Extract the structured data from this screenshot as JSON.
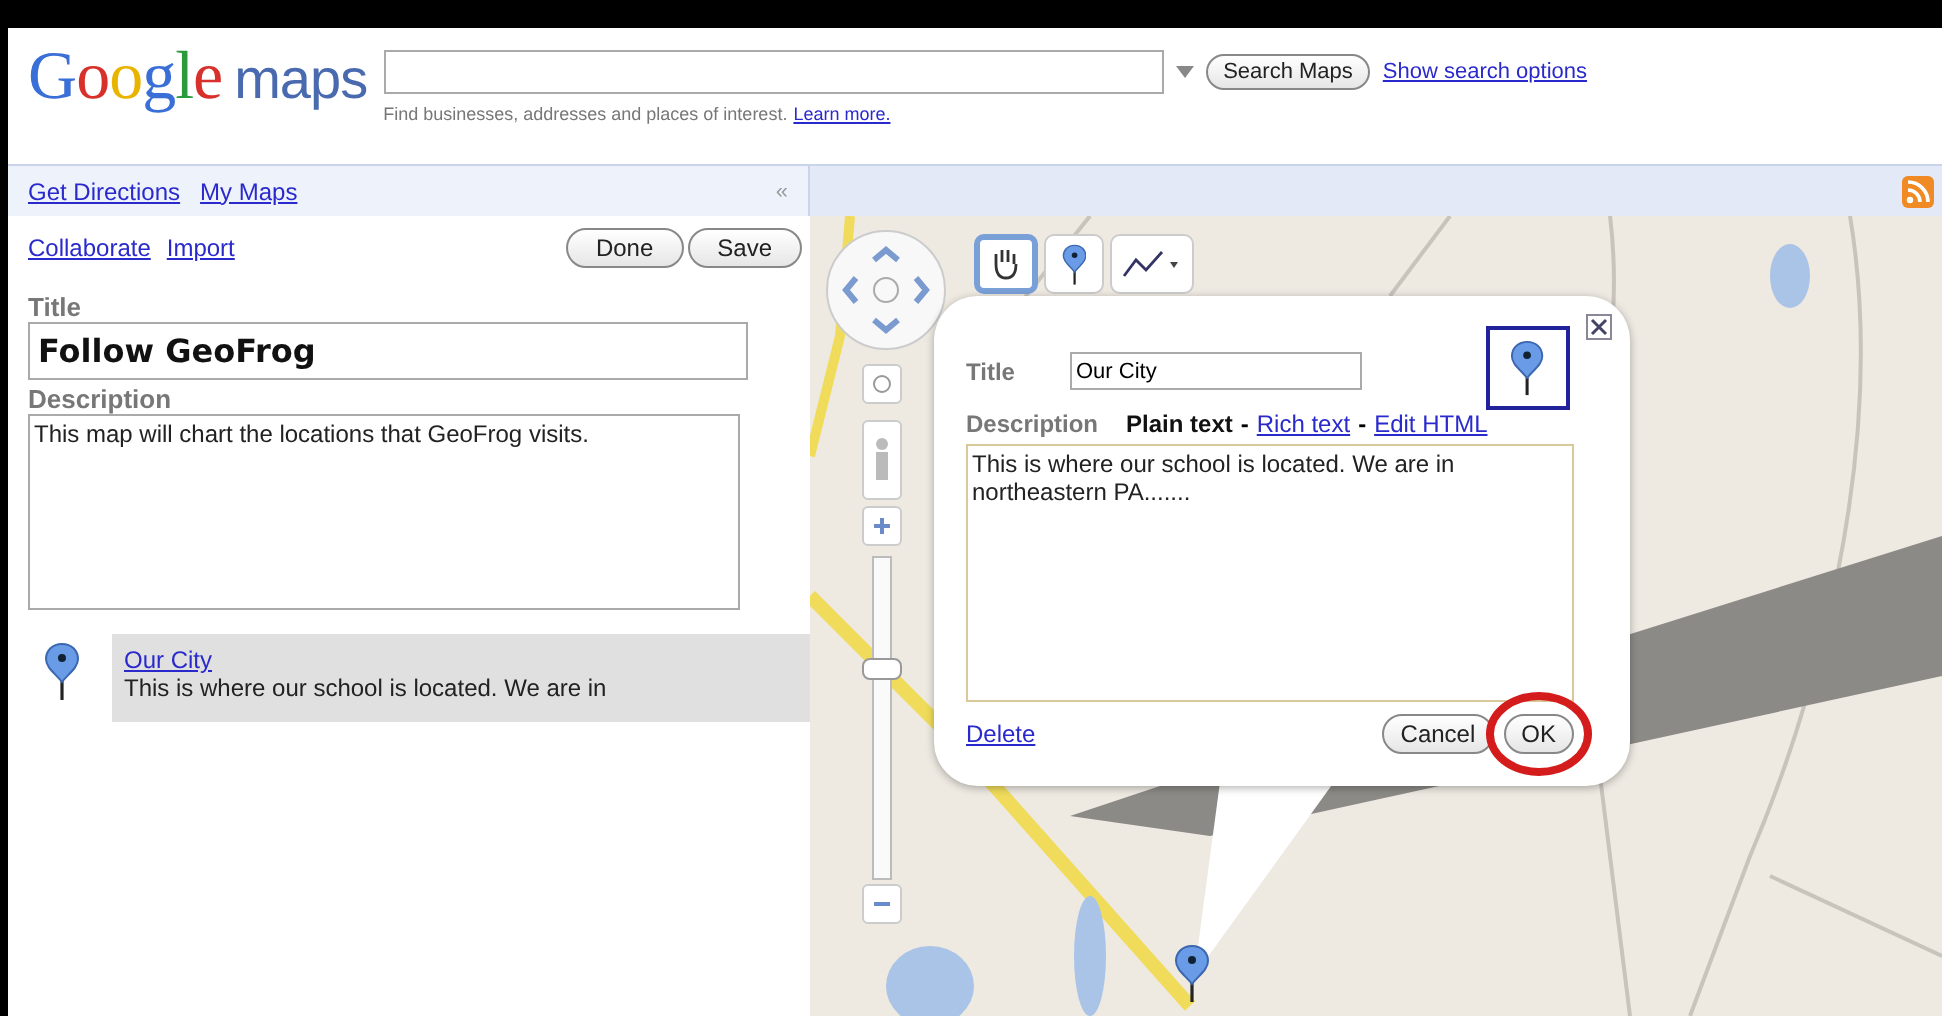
{
  "header": {
    "logo": {
      "brand": "Google",
      "product": "maps"
    },
    "search": {
      "hint": "Find businesses, addresses and places of interest.",
      "hint_link": "Learn more.",
      "button": "Search Maps",
      "options_link": "Show search options"
    }
  },
  "nav": {
    "links": [
      "Get Directions",
      "My Maps"
    ],
    "collapse": "«"
  },
  "panel": {
    "links": [
      "Collaborate",
      "Import"
    ],
    "buttons": [
      "Done",
      "Save"
    ],
    "title_label": "Title",
    "title_value": "Follow GeoFrog",
    "description_label": "Description",
    "description_value": "This map will chart the locations that GeoFrog visits.",
    "places": [
      {
        "name": "Our City",
        "snippet": "This is where our school is located. We are in"
      }
    ]
  },
  "map": {
    "tools": [
      {
        "kind": "hand",
        "selected": true
      },
      {
        "kind": "marker",
        "selected": false
      },
      {
        "kind": "line",
        "selected": false
      }
    ],
    "zoom": {
      "level": 0.66
    },
    "popup": {
      "title_label": "Title",
      "title_value": "Our City",
      "description_label": "Description",
      "separator": "-",
      "format_options": [
        {
          "label": "Plain text",
          "selected": true
        },
        {
          "label": "Rich text",
          "selected": false
        },
        {
          "label": "Edit HTML",
          "selected": false
        }
      ],
      "description_value": "This is where our school is located. We are in northeastern PA.......",
      "delete": "Delete",
      "buttons": [
        {
          "label": "Cancel",
          "highlighted": false
        },
        {
          "label": "OK",
          "highlighted": true
        }
      ]
    }
  }
}
